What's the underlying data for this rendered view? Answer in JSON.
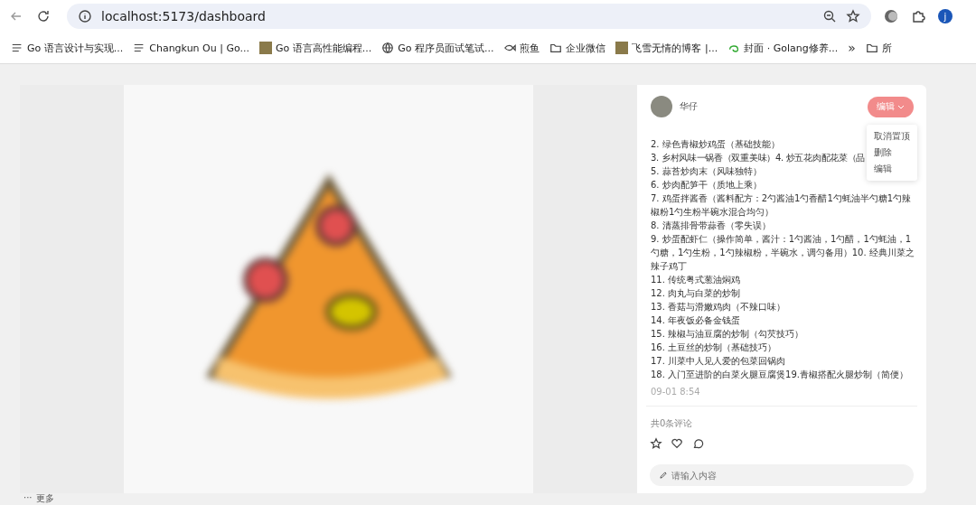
{
  "browser": {
    "url": "localhost:5173/dashboard",
    "profile_initial": "j"
  },
  "bookmarks": [
    {
      "kind": "list",
      "label": "Go 语言设计与实现..."
    },
    {
      "kind": "list",
      "label": "Changkun Ou | Go..."
    },
    {
      "kind": "image",
      "label": "Go 语言高性能编程..."
    },
    {
      "kind": "globe",
      "label": "Go 程序员面试笔试..."
    },
    {
      "kind": "fish",
      "label": "煎鱼"
    },
    {
      "kind": "folder",
      "label": "企业微信"
    },
    {
      "kind": "image",
      "label": "飞雪无情的博客 |..."
    },
    {
      "kind": "swirl",
      "label": "封面 · Golang修养..."
    }
  ],
  "bookmarks_more": "»",
  "bookmarks_overflow": "所",
  "sidebar_more": {
    "icon": "···",
    "label": "更多"
  },
  "post": {
    "author": "华仔",
    "menu_button": "编辑",
    "menu": [
      {
        "label": "取消置顶"
      },
      {
        "label": "删除"
      },
      {
        "label": "编辑"
      }
    ],
    "lines": [
      "2. 绿色青椒炒鸡蛋（基础技能）",
      "3. 乡村风味一锅香（双重美味）4. 炒五花肉配花菜（品",
      "5. 蒜苔炒肉末（风味独特）",
      "6. 炒肉配笋干（质地上乘）",
      "7. 鸡蛋拌酱香（酱料配方：2勺酱油1勺香醋1勺蚝油半勺糖1勺辣椒粉1勺生粉半碗水混合均匀）",
      "8. 清蒸排骨带蒜香（零失误）",
      "9. 炒蛋配虾仁（操作简单，酱汁：1勺酱油，1勺醋，1勺蚝油，1勺糖，1勺生粉，1勺辣椒粉，半碗水，调匀备用）10. 经典川菜之辣子鸡丁",
      "11. 传统粤式葱油焖鸡",
      "12. 肉丸与白菜的炒制",
      "13. 香菇与滑嫩鸡肉（不辣口味）",
      "14. 年夜饭必备金钱蛋",
      "15. 辣椒与油豆腐的炒制（勾芡技巧）",
      "16. 土豆丝的炒制（基础技巧）",
      "17. 川菜中人见人爱的包菜回锅肉",
      "18. 入门至进阶的白菜火腿豆腐煲19.青椒搭配火腿炒制（简便）"
    ],
    "time": "09-01 8:54",
    "comments_count": "共0条评论",
    "comment_input": {
      "placeholder": "请输入内容"
    }
  }
}
